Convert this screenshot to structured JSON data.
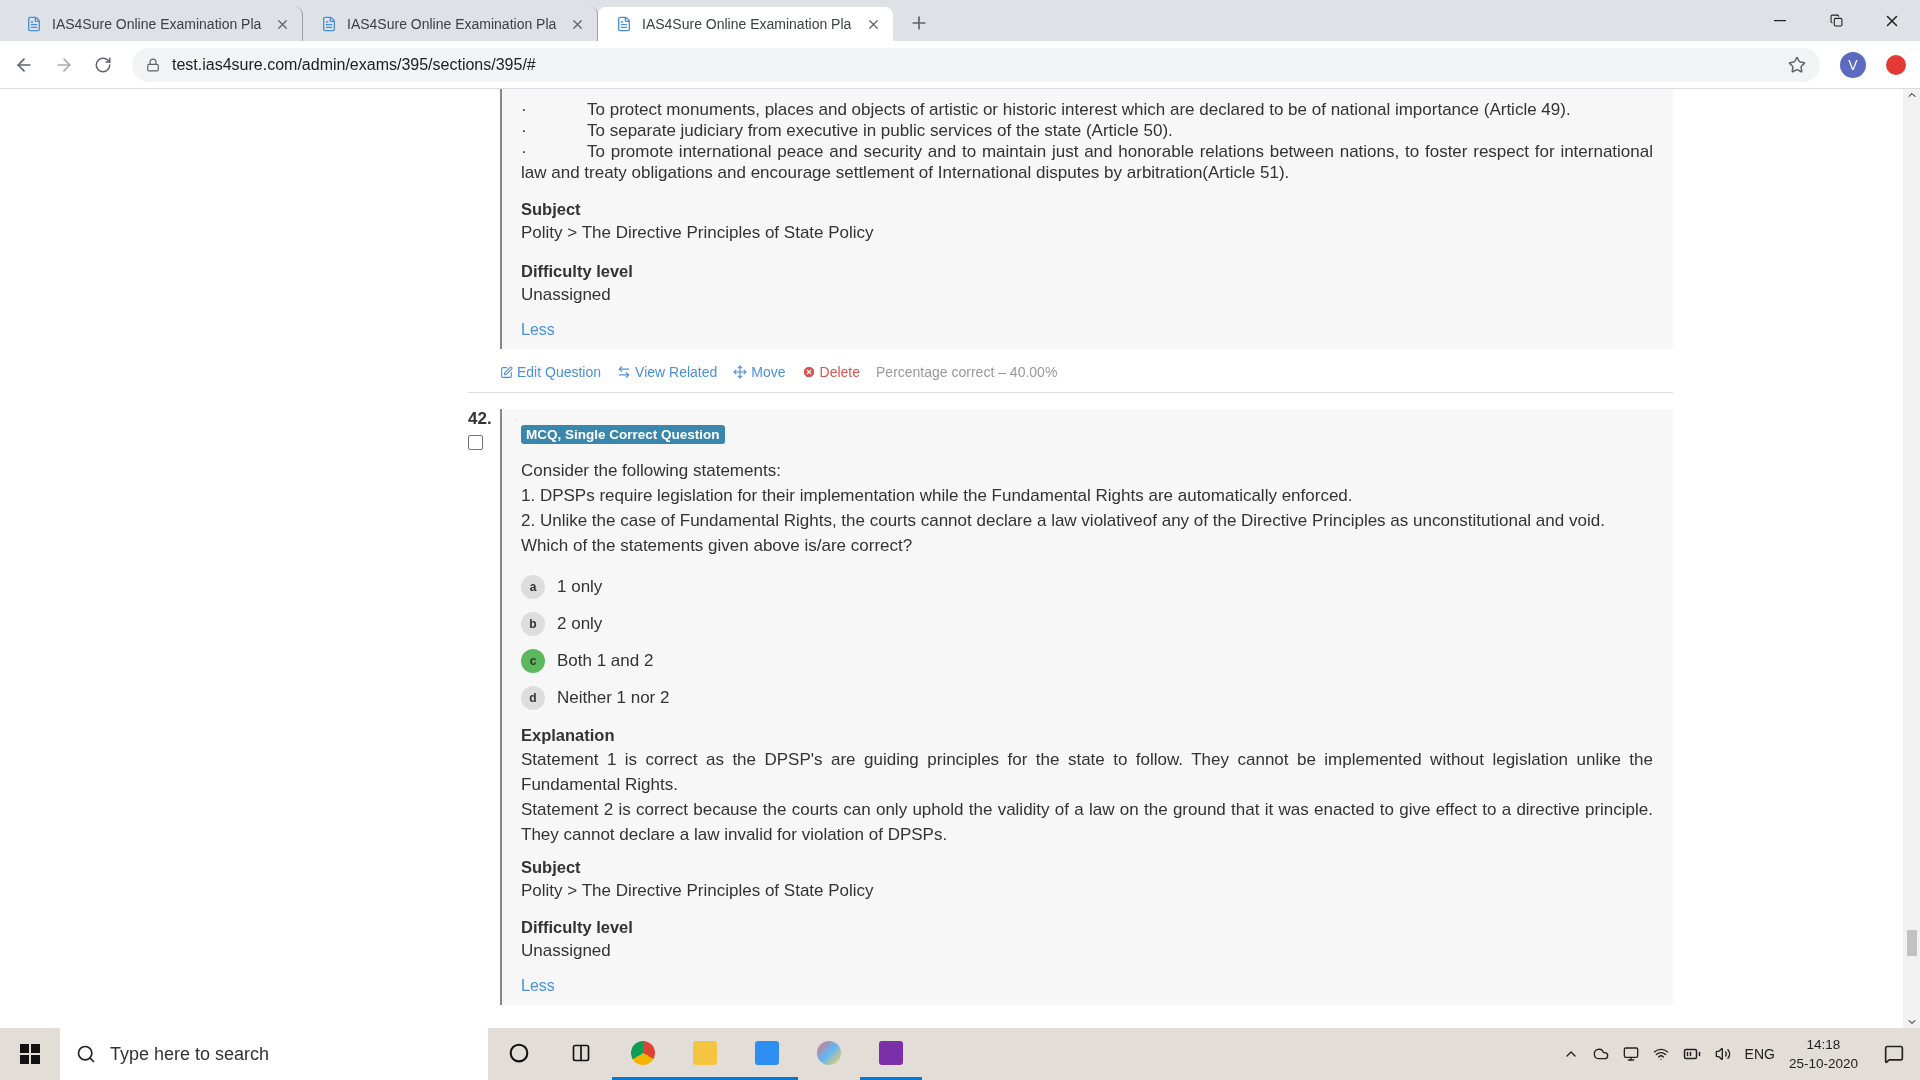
{
  "browser": {
    "tabs": [
      {
        "title": "IAS4Sure Online Examination Pla",
        "selected": false
      },
      {
        "title": "IAS4Sure Online Examination Pla",
        "selected": false
      },
      {
        "title": "IAS4Sure Online Examination Pla",
        "selected": true
      }
    ],
    "url": "test.ias4sure.com/admin/exams/395/sections/395/#",
    "profile_initial": "V"
  },
  "previous_question": {
    "bullets": [
      {
        "marker": "·",
        "text": "To protect monuments, places and objects of artistic or historic interest which are declared to be of national importance (Article 49)."
      },
      {
        "marker": "·",
        "text": "To separate judiciary from executive in public services of the state (Article 50)."
      },
      {
        "marker": "·",
        "text": "To promote international peace and security and to maintain just and honorable relations between nations, to foster respect for international law and treaty obligations and encourage settlement of International disputes by arbitration(Article 51)."
      }
    ],
    "subject_label": "Subject",
    "subject": "Polity > The Directive Principles of State Policy",
    "difficulty_label": "Difficulty level",
    "difficulty": "Unassigned",
    "toggle": "Less",
    "actions": [
      {
        "kind": "edit",
        "label": "Edit Question"
      },
      {
        "kind": "related",
        "label": "View Related"
      },
      {
        "kind": "move",
        "label": "Move"
      },
      {
        "kind": "delete",
        "label": "Delete"
      }
    ],
    "stat": "Percentage correct – 40.00%"
  },
  "question": {
    "number": "42.",
    "checked": false,
    "type_badge": "MCQ, Single Correct Question",
    "stem": [
      "Consider the following statements:",
      "1. DPSPs require legislation for their implementation while the Fundamental Rights are automatically enforced.",
      "2. Unlike the case of Fundamental Rights, the courts cannot declare a law violativeof any of the Directive Principles as unconstitutional and void.",
      "Which of the statements given above is/are correct?"
    ],
    "options": [
      {
        "letter": "a",
        "text": "1 only",
        "selected": false
      },
      {
        "letter": "b",
        "text": "2 only",
        "selected": false
      },
      {
        "letter": "c",
        "text": "Both 1 and 2",
        "selected": true
      },
      {
        "letter": "d",
        "text": "Neither 1 nor 2",
        "selected": false
      }
    ],
    "explanation_label": "Explanation",
    "explanation": [
      "Statement 1 is correct as the DPSP's are guiding principles for the state to follow. They cannot be implemented without legislation unlike the Fundamental Rights.",
      "Statement 2 is correct because the courts can only uphold the validity of a law on the ground that it was enacted to give effect to a directive principle. They cannot declare a law invalid for violation of DPSPs."
    ],
    "subject_label": "Subject",
    "subject": "Polity > The Directive Principles of State Policy",
    "difficulty_label": "Difficulty level",
    "difficulty": "Unassigned",
    "toggle": "Less"
  },
  "taskbar": {
    "search_placeholder": "Type here to search",
    "language": "ENG",
    "time": "14:18",
    "date": "25-10-2020"
  }
}
